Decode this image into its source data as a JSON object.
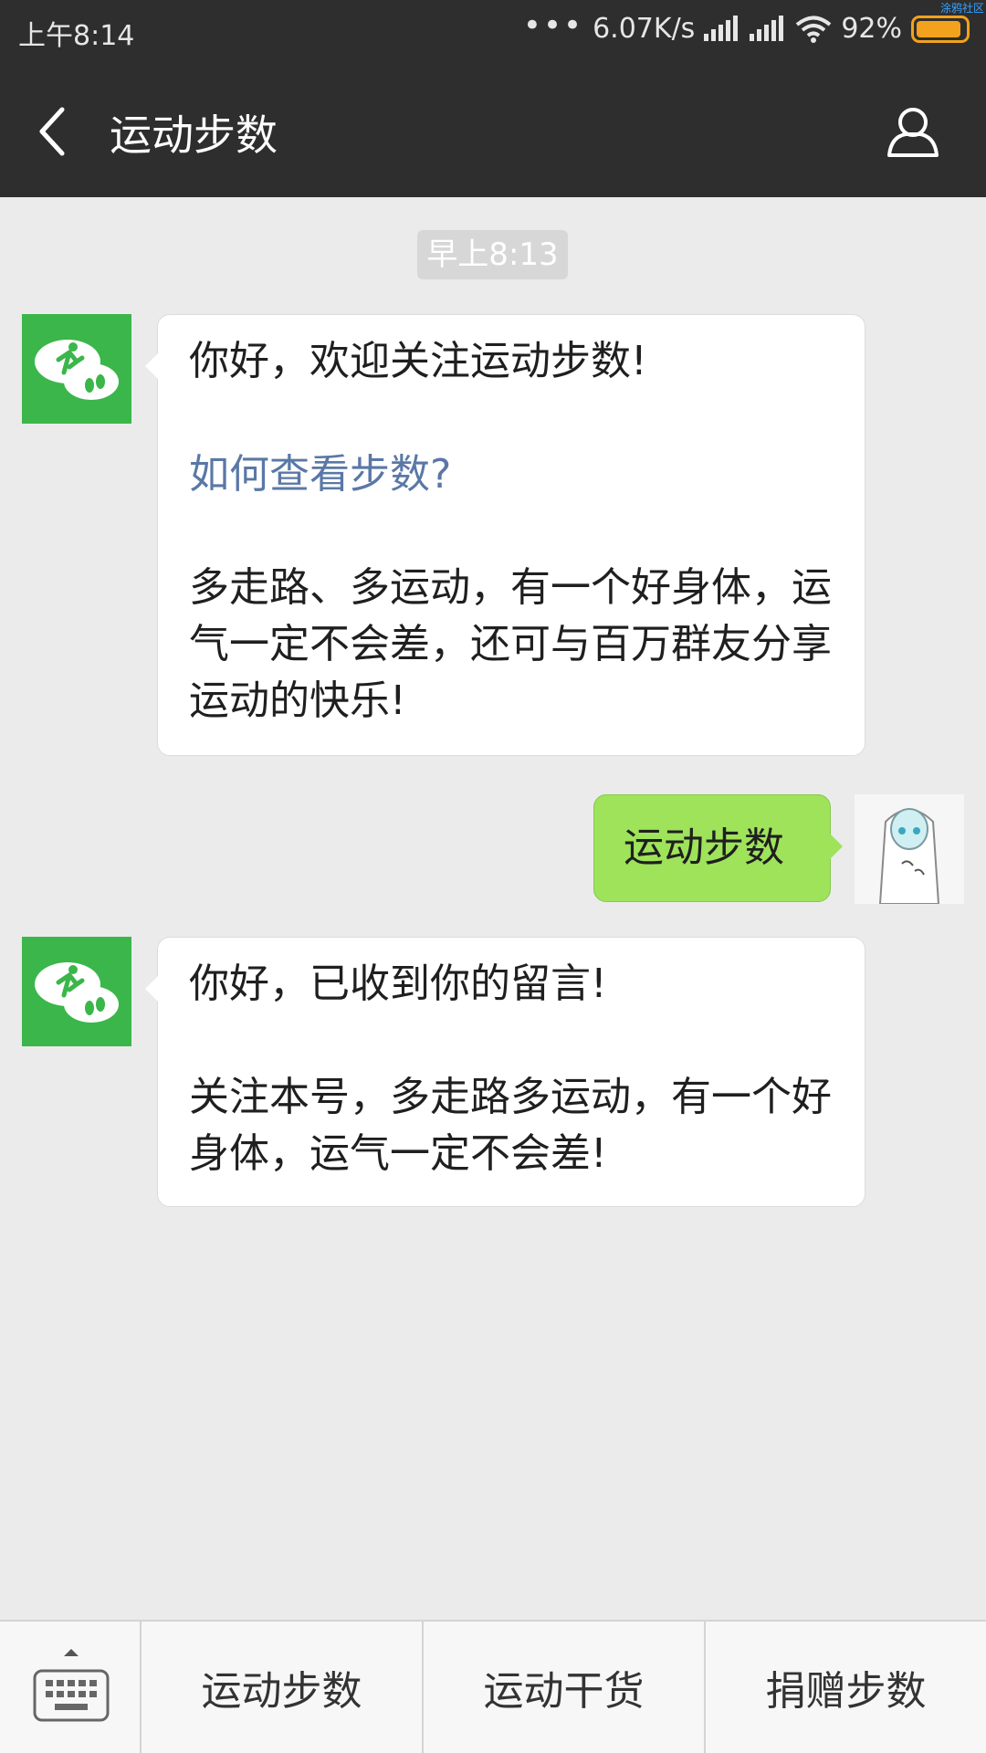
{
  "status_bar": {
    "time": "上午8:14",
    "network_speed": "6.07K/s",
    "battery": "92%",
    "watermark": "涂鸦社区"
  },
  "nav": {
    "title": "运动步数",
    "back_icon": "back-arrow-icon",
    "profile_icon": "person-icon"
  },
  "chat": {
    "timestamp": "早上8:13",
    "message1": {
      "line1": "你好，欢迎关注运动步数!",
      "link": "如何查看步数?",
      "body": "多走路、多运动，有一个好身体，运气一定不会差，还可与百万群友分享运动的快乐!"
    },
    "my_message": "运动步数",
    "message2": {
      "line1": "你好，已收到你的留言!",
      "body": "关注本号，多走路多运动，有一个好身体，运气一定不会差!"
    }
  },
  "bottom_menu": {
    "keyboard_icon": "keyboard-icon",
    "items": [
      "运动步数",
      "运动干货",
      "捐赠步数"
    ]
  },
  "colors": {
    "header_bg": "#2e2e2e",
    "chat_bg": "#ebebeb",
    "account_green": "#3bb64a",
    "my_bubble": "#9ee35a",
    "link": "#5a78a6",
    "battery": "#f2a21c"
  }
}
